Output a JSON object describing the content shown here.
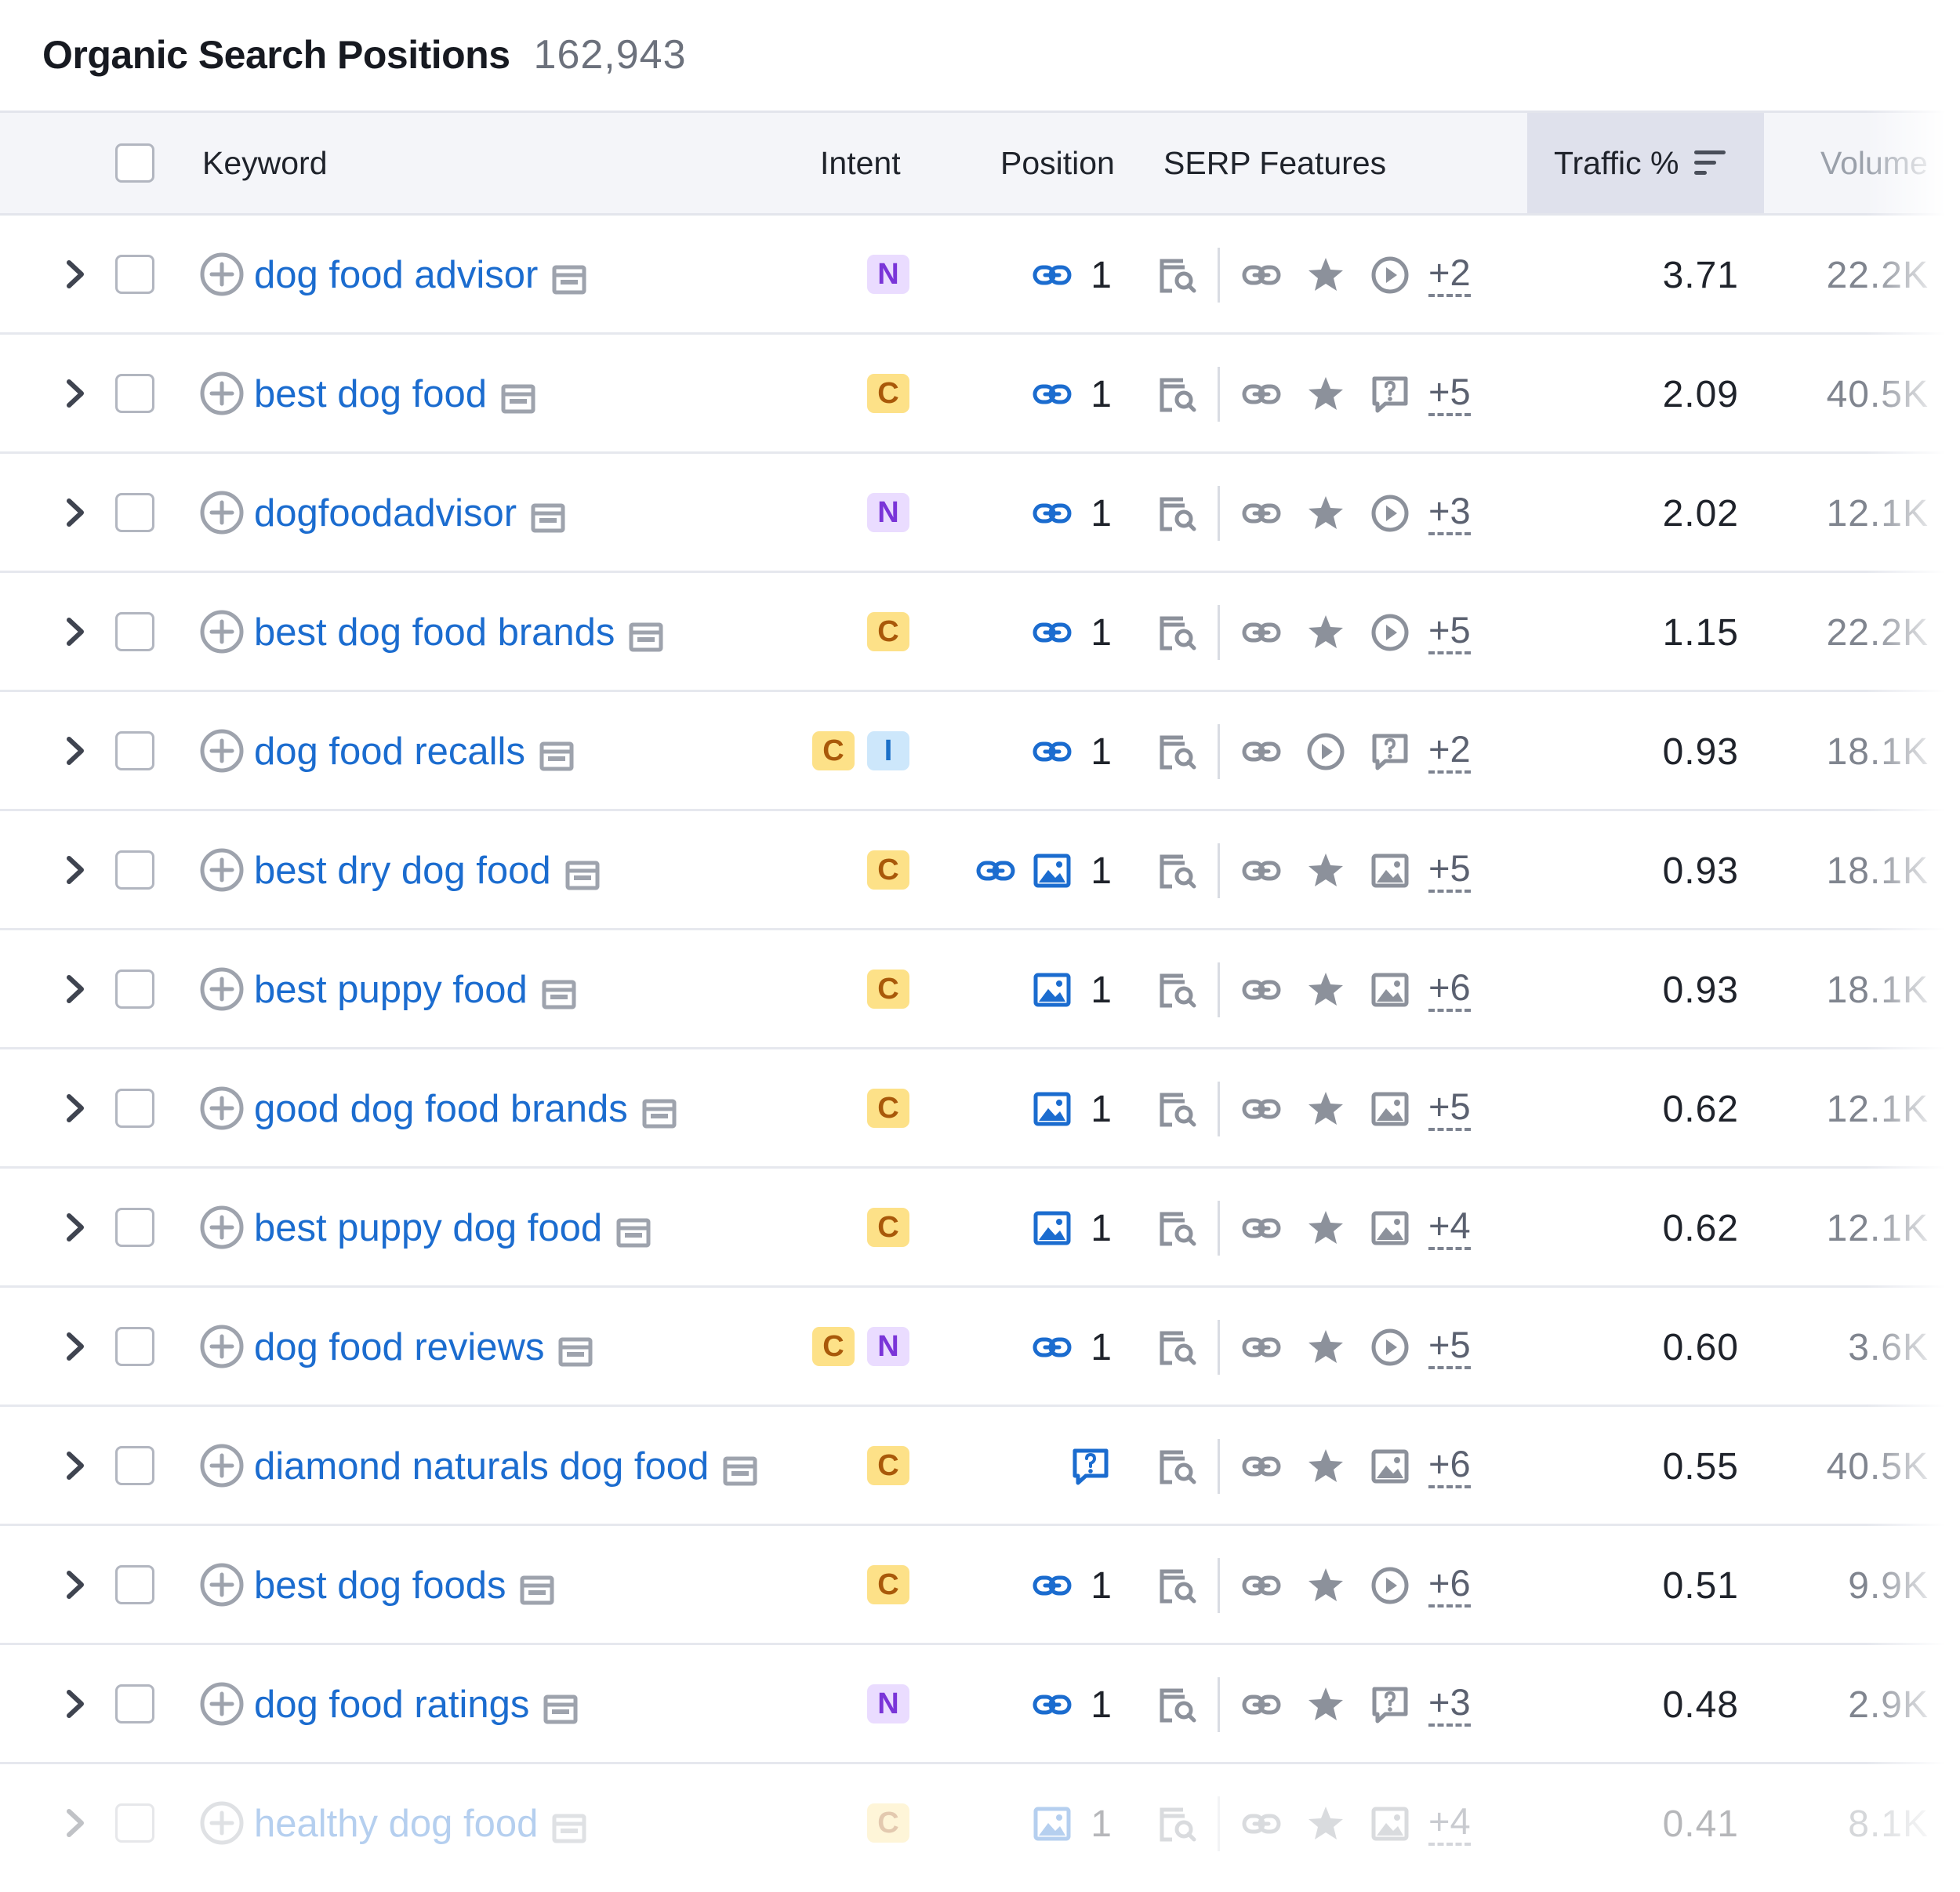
{
  "panel": {
    "title": "Organic Search Positions",
    "count": "162,943"
  },
  "columns": {
    "keyword": "Keyword",
    "intent": "Intent",
    "position": "Position",
    "serp_features": "SERP Features",
    "traffic": "Traffic %",
    "volume": "Volume"
  },
  "sort": {
    "column": "Traffic %",
    "icon": "sort-descending-icon"
  },
  "colors": {
    "link": "#1b6ccf",
    "intent_N": "#7a35d8",
    "intent_C": "#a9590a",
    "intent_I": "#1b70c8",
    "header_bg": "#f4f5f9",
    "active_column_bg": "#dfe1ec"
  },
  "rows": [
    {
      "keyword": "dog food advisor",
      "intents": [
        "N"
      ],
      "position_icons": [
        "link-icon"
      ],
      "position": "1",
      "serp_icons": [
        "link-icon",
        "star-icon",
        "video-icon"
      ],
      "serp_more": "+2",
      "traffic": "3.71",
      "volume": "22.2K"
    },
    {
      "keyword": "best dog food",
      "intents": [
        "C"
      ],
      "position_icons": [
        "link-icon"
      ],
      "position": "1",
      "serp_icons": [
        "link-icon",
        "star-icon",
        "question-icon"
      ],
      "serp_more": "+5",
      "traffic": "2.09",
      "volume": "40.5K"
    },
    {
      "keyword": "dogfoodadvisor",
      "intents": [
        "N"
      ],
      "position_icons": [
        "link-icon"
      ],
      "position": "1",
      "serp_icons": [
        "link-icon",
        "star-icon",
        "video-icon"
      ],
      "serp_more": "+3",
      "traffic": "2.02",
      "volume": "12.1K"
    },
    {
      "keyword": "best dog food brands",
      "intents": [
        "C"
      ],
      "position_icons": [
        "link-icon"
      ],
      "position": "1",
      "serp_icons": [
        "link-icon",
        "star-icon",
        "video-icon"
      ],
      "serp_more": "+5",
      "traffic": "1.15",
      "volume": "22.2K"
    },
    {
      "keyword": "dog food recalls",
      "intents": [
        "C",
        "I"
      ],
      "position_icons": [
        "link-icon"
      ],
      "position": "1",
      "serp_icons": [
        "link-icon",
        "video-icon",
        "question-icon"
      ],
      "serp_more": "+2",
      "traffic": "0.93",
      "volume": "18.1K"
    },
    {
      "keyword": "best dry dog food",
      "intents": [
        "C"
      ],
      "position_icons": [
        "link-icon",
        "image-icon"
      ],
      "position": "1",
      "serp_icons": [
        "link-icon",
        "star-icon",
        "image-icon"
      ],
      "serp_more": "+5",
      "traffic": "0.93",
      "volume": "18.1K"
    },
    {
      "keyword": "best puppy food",
      "intents": [
        "C"
      ],
      "position_icons": [
        "image-icon"
      ],
      "position": "1",
      "serp_icons": [
        "link-icon",
        "star-icon",
        "image-icon"
      ],
      "serp_more": "+6",
      "traffic": "0.93",
      "volume": "18.1K"
    },
    {
      "keyword": "good dog food brands",
      "intents": [
        "C"
      ],
      "position_icons": [
        "image-icon"
      ],
      "position": "1",
      "serp_icons": [
        "link-icon",
        "star-icon",
        "image-icon"
      ],
      "serp_more": "+5",
      "traffic": "0.62",
      "volume": "12.1K"
    },
    {
      "keyword": "best puppy dog food",
      "intents": [
        "C"
      ],
      "position_icons": [
        "image-icon"
      ],
      "position": "1",
      "serp_icons": [
        "link-icon",
        "star-icon",
        "image-icon"
      ],
      "serp_more": "+4",
      "traffic": "0.62",
      "volume": "12.1K"
    },
    {
      "keyword": "dog food reviews",
      "intents": [
        "C",
        "N"
      ],
      "position_icons": [
        "link-icon"
      ],
      "position": "1",
      "serp_icons": [
        "link-icon",
        "star-icon",
        "video-icon"
      ],
      "serp_more": "+5",
      "traffic": "0.60",
      "volume": "3.6K"
    },
    {
      "keyword": "diamond naturals dog food",
      "intents": [
        "C"
      ],
      "position_icons": [
        "question-icon"
      ],
      "position": "",
      "serp_icons": [
        "link-icon",
        "star-icon",
        "image-icon"
      ],
      "serp_more": "+6",
      "traffic": "0.55",
      "volume": "40.5K"
    },
    {
      "keyword": "best dog foods",
      "intents": [
        "C"
      ],
      "position_icons": [
        "link-icon"
      ],
      "position": "1",
      "serp_icons": [
        "link-icon",
        "star-icon",
        "video-icon"
      ],
      "serp_more": "+6",
      "traffic": "0.51",
      "volume": "9.9K"
    },
    {
      "keyword": "dog food ratings",
      "intents": [
        "N"
      ],
      "position_icons": [
        "link-icon"
      ],
      "position": "1",
      "serp_icons": [
        "link-icon",
        "star-icon",
        "question-icon"
      ],
      "serp_more": "+3",
      "traffic": "0.48",
      "volume": "2.9K"
    },
    {
      "keyword": "healthy dog food",
      "intents": [
        "C"
      ],
      "position_icons": [
        "image-icon"
      ],
      "position": "1",
      "serp_icons": [
        "link-icon",
        "star-icon",
        "image-icon"
      ],
      "serp_more": "+4",
      "traffic": "0.41",
      "volume": "8.1K"
    }
  ]
}
